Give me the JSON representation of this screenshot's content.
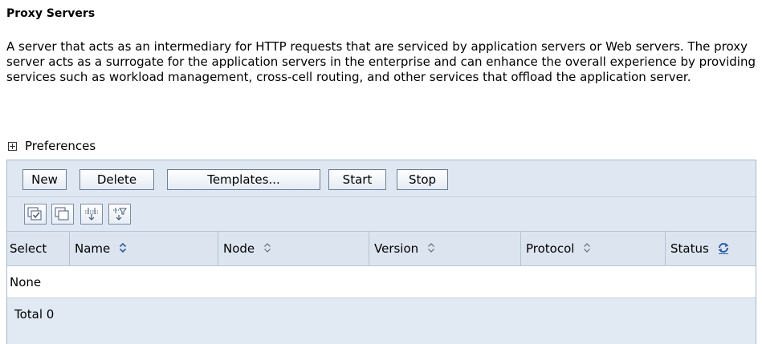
{
  "page": {
    "title": "Proxy Servers",
    "description": "A server that acts as an intermediary for HTTP requests that are serviced by application servers or Web servers. The proxy server acts as a surrogate for the application servers in the enterprise and can enhance the overall experience by providing services such as workload management, cross-cell routing, and other services that offload the application server.",
    "preferences_label": "Preferences"
  },
  "toolbar": {
    "new_label": "New",
    "delete_label": "Delete",
    "templates_label": "Templates...",
    "start_label": "Start",
    "stop_label": "Stop"
  },
  "icon_toolbar": {
    "icons": [
      "select-all-icon",
      "deselect-all-icon",
      "show-filter-icon",
      "clear-filter-icon"
    ]
  },
  "table": {
    "columns": [
      "Select",
      "Name",
      "Node",
      "Version",
      "Protocol",
      "Status"
    ],
    "empty_text": "None",
    "total_text": "Total 0"
  },
  "colors": {
    "panel_bg": "#e1e9f3",
    "border": "#a9b9cc",
    "sort_icon": "#2b5fa8"
  }
}
